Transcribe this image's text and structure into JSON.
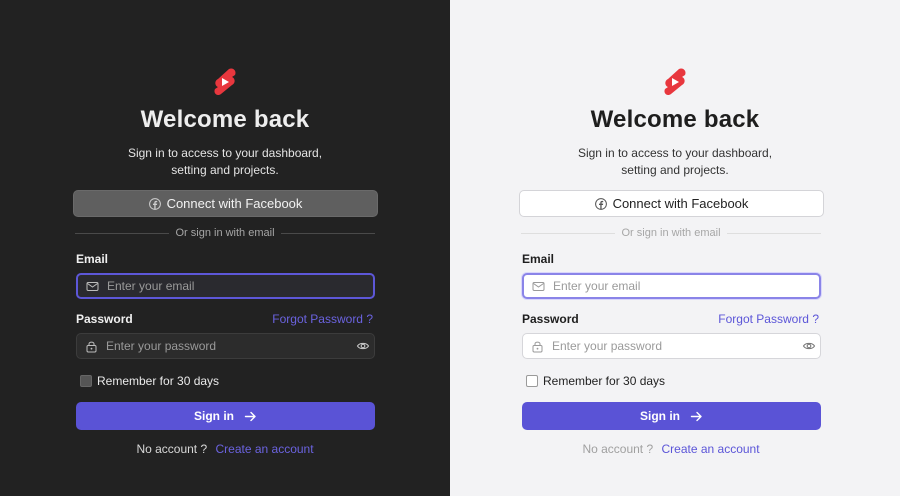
{
  "brand_color": "#e8373e",
  "accent_color": "#5a53d6",
  "themes": [
    {
      "name": "dark",
      "title": "Welcome back",
      "subtitle_line1": "Sign in to access to your dashboard,",
      "subtitle_line2": "setting and projects.",
      "facebook_button": "Connect with Facebook",
      "divider_text": "Or sign in with email",
      "email_label": "Email",
      "email_placeholder": "Enter your email",
      "password_label": "Password",
      "forgot_link": "Forgot Password ?",
      "password_placeholder": "Enter your password",
      "remember_label": "Remember for 30 days",
      "signin_button": "Sign in",
      "no_account_text": "No account ?",
      "create_account_link": "Create an account"
    },
    {
      "name": "light",
      "title": "Welcome back",
      "subtitle_line1": "Sign in to access to your dashboard,",
      "subtitle_line2": "setting and projects.",
      "facebook_button": "Connect with Facebook",
      "divider_text": "Or sign in with email",
      "email_label": "Email",
      "email_placeholder": "Enter your email",
      "password_label": "Password",
      "forgot_link": "Forgot Password ?",
      "password_placeholder": "Enter your password",
      "remember_label": "Remember for 30 days",
      "signin_button": "Sign in",
      "no_account_text": "No account ?",
      "create_account_link": "Create an account"
    }
  ]
}
